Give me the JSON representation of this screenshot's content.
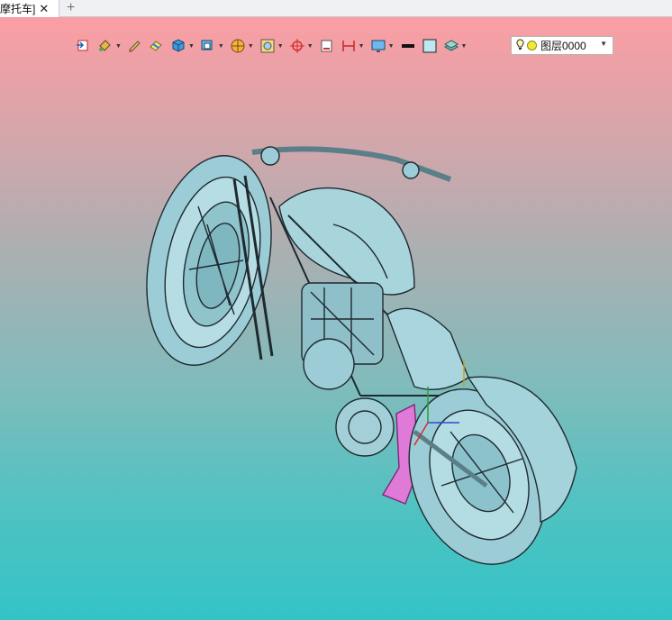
{
  "tab": {
    "title": "摩托车]",
    "close_icon": "close-icon",
    "add_icon": "plus-icon"
  },
  "toolbar": {
    "tools": [
      {
        "name": "exit-icon",
        "has_menu": false
      },
      {
        "name": "paint-bucket-icon",
        "has_menu": true
      },
      {
        "name": "pencil-icon",
        "has_menu": false
      },
      {
        "name": "eraser-icon",
        "has_menu": false
      },
      {
        "name": "cube-icon",
        "has_menu": true
      },
      {
        "name": "view-box-icon",
        "has_menu": true
      },
      {
        "name": "render-sphere-icon",
        "has_menu": true
      },
      {
        "name": "frame-icon",
        "has_menu": true
      },
      {
        "name": "crosshair-icon",
        "has_menu": true
      },
      {
        "name": "section-icon",
        "has_menu": false
      },
      {
        "name": "dimension-icon",
        "has_menu": true
      },
      {
        "name": "monitor-icon",
        "has_menu": true
      },
      {
        "name": "line-weight-icon",
        "has_menu": false
      },
      {
        "name": "color-swatch-icon",
        "has_menu": false
      },
      {
        "name": "layers-icon",
        "has_menu": true
      }
    ],
    "layer": {
      "bulb_icon": "lightbulb-icon",
      "color": "#f2ea38",
      "label": "图层0000",
      "dropdown_icon": "chevron-down-icon"
    }
  },
  "viewport": {
    "background_top": "#fb9ea4",
    "background_bottom": "#33c4c6",
    "model_color": "#9ccdd6",
    "highlight_color": "#e07ad8"
  }
}
